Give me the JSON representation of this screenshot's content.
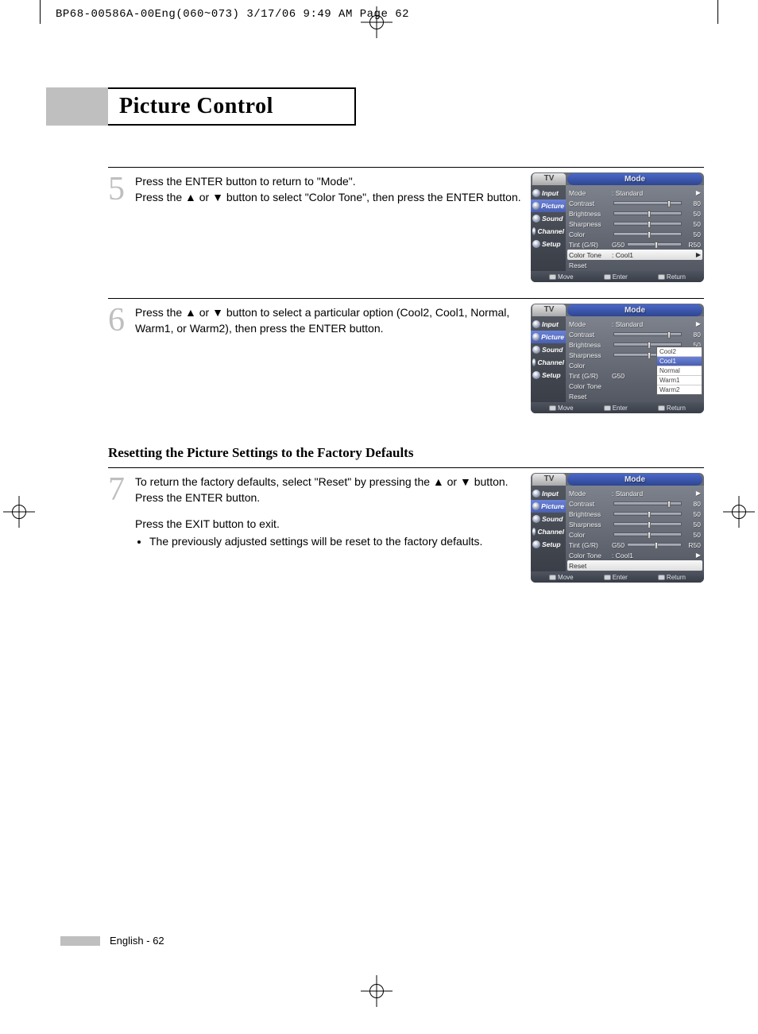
{
  "print_header": "BP68-00586A-00Eng(060~073)  3/17/06  9:49 AM  Page 62",
  "page_title": "Picture Control",
  "subsection_title": "Resetting the Picture Settings to the Factory Defaults",
  "footer_text": "English - 62",
  "steps": {
    "s5": {
      "num": "5",
      "text": "Press the ENTER button to return to \"Mode\".\nPress the ▲ or ▼ button to select \"Color Tone\", then press the ENTER button."
    },
    "s6": {
      "num": "6",
      "text": "Press the ▲ or ▼ button to select a particular option (Cool2, Cool1, Normal, Warm1, or Warm2), then press the ENTER button."
    },
    "s7": {
      "num": "7",
      "text1": "To return the factory defaults, select \"Reset\" by pressing the ▲ or ▼ button. Press the ENTER button.",
      "text2": "Press the EXIT button to exit.",
      "bullet": "The previously adjusted settings will be reset to the factory defaults."
    }
  },
  "osd_common": {
    "tv_label": "TV",
    "header_title": "Mode",
    "sidebar": [
      "Input",
      "Picture",
      "Sound",
      "Channel",
      "Setup"
    ],
    "footer": {
      "move": "Move",
      "enter": "Enter",
      "return": "Return"
    }
  },
  "osd5": {
    "rows": [
      {
        "label": "Mode",
        "value": ": Standard",
        "type": "text_arrow"
      },
      {
        "label": "Contrast",
        "value": "80",
        "type": "slider",
        "pct": 80
      },
      {
        "label": "Brightness",
        "value": "50",
        "type": "slider",
        "pct": 50
      },
      {
        "label": "Sharpness",
        "value": "50",
        "type": "slider",
        "pct": 50
      },
      {
        "label": "Color",
        "value": "50",
        "type": "slider",
        "pct": 50
      },
      {
        "label": "Tint (G/R)",
        "prefix": "G50",
        "value": "R50",
        "type": "slider",
        "pct": 50
      },
      {
        "label": "Color Tone",
        "value": ": Cool1",
        "type": "text_arrow",
        "highlight": true
      },
      {
        "label": "Reset",
        "value": "",
        "type": "text"
      }
    ]
  },
  "osd6": {
    "rows": [
      {
        "label": "Mode",
        "value": ": Standard",
        "type": "text_arrow"
      },
      {
        "label": "Contrast",
        "value": "80",
        "type": "slider",
        "pct": 80
      },
      {
        "label": "Brightness",
        "value": "50",
        "type": "slider",
        "pct": 50
      },
      {
        "label": "Sharpness",
        "value": "50",
        "type": "slider",
        "pct": 50
      },
      {
        "label": "Color",
        "value": "",
        "type": "text"
      },
      {
        "label": "Tint (G/R)",
        "prefix": "G50",
        "value": "",
        "type": "text"
      },
      {
        "label": "Color Tone",
        "value": "",
        "type": "text"
      },
      {
        "label": "Reset",
        "value": "",
        "type": "text"
      }
    ],
    "dropdown": {
      "options": [
        "Cool2",
        "Cool1",
        "Normal",
        "Warm1",
        "Warm2"
      ],
      "selected": "Cool1"
    }
  },
  "osd7": {
    "rows": [
      {
        "label": "Mode",
        "value": ": Standard",
        "type": "text_arrow"
      },
      {
        "label": "Contrast",
        "value": "80",
        "type": "slider",
        "pct": 80
      },
      {
        "label": "Brightness",
        "value": "50",
        "type": "slider",
        "pct": 50
      },
      {
        "label": "Sharpness",
        "value": "50",
        "type": "slider",
        "pct": 50
      },
      {
        "label": "Color",
        "value": "50",
        "type": "slider",
        "pct": 50
      },
      {
        "label": "Tint (G/R)",
        "prefix": "G50",
        "value": "R50",
        "type": "slider",
        "pct": 50
      },
      {
        "label": "Color Tone",
        "value": ": Cool1",
        "type": "text_arrow"
      },
      {
        "label": "Reset",
        "value": "",
        "type": "text",
        "highlight": true
      }
    ]
  }
}
